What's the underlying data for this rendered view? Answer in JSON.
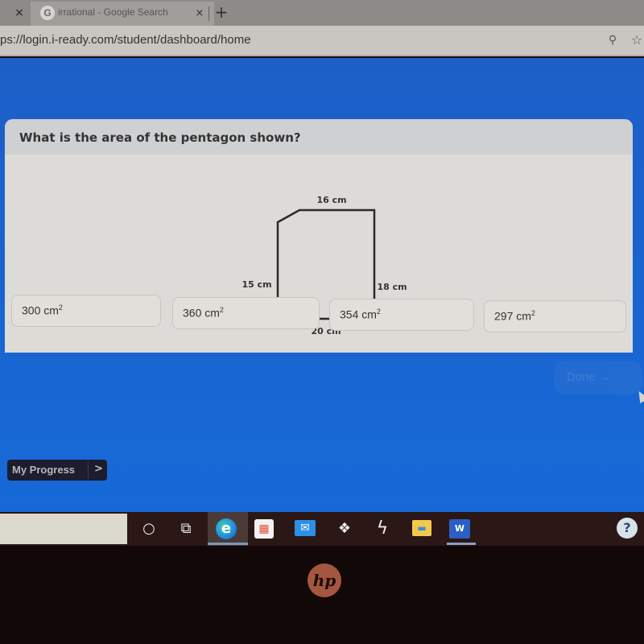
{
  "browser": {
    "active_tab": {
      "title": "irrational - Google Search",
      "favicon": "google-g-icon",
      "favicon_glyph": "G"
    },
    "close_glyph": "×",
    "new_tab_glyph": "+",
    "url": "ps://login.i-ready.com/student/dashboard/home",
    "key_glyph": "⚲",
    "star_glyph": "☆"
  },
  "question": {
    "prompt": "What is the area of the pentagon shown?",
    "figure": {
      "shape": "pentagon",
      "labels": {
        "top": "16 cm",
        "left": "15 cm",
        "right": "18 cm",
        "bottom": "20 cm"
      }
    }
  },
  "choices": [
    {
      "value": "300 cm",
      "exp": "2"
    },
    {
      "value": "360 cm",
      "exp": "2"
    },
    {
      "value": "354 cm",
      "exp": "2"
    },
    {
      "value": "297 cm",
      "exp": "2"
    }
  ],
  "done_button": {
    "label": "Done →"
  },
  "my_progress": {
    "label": "My Progress",
    "arrow": ">"
  },
  "taskbar": {
    "icons": [
      {
        "name": "cortana-icon",
        "glyph": "○"
      },
      {
        "name": "task-view-icon",
        "glyph": "⧉"
      },
      {
        "name": "edge-icon",
        "glyph": "e"
      },
      {
        "name": "store-icon",
        "glyph": "▦"
      },
      {
        "name": "mail-icon",
        "glyph": "✉"
      },
      {
        "name": "dropbox-icon",
        "glyph": "❖"
      },
      {
        "name": "app-bolt-icon",
        "glyph": "ϟ"
      },
      {
        "name": "file-explorer-icon",
        "glyph": "▬"
      },
      {
        "name": "word-icon",
        "glyph": "W"
      }
    ],
    "help_glyph": "?"
  },
  "bezel": {
    "logo": "hp"
  }
}
